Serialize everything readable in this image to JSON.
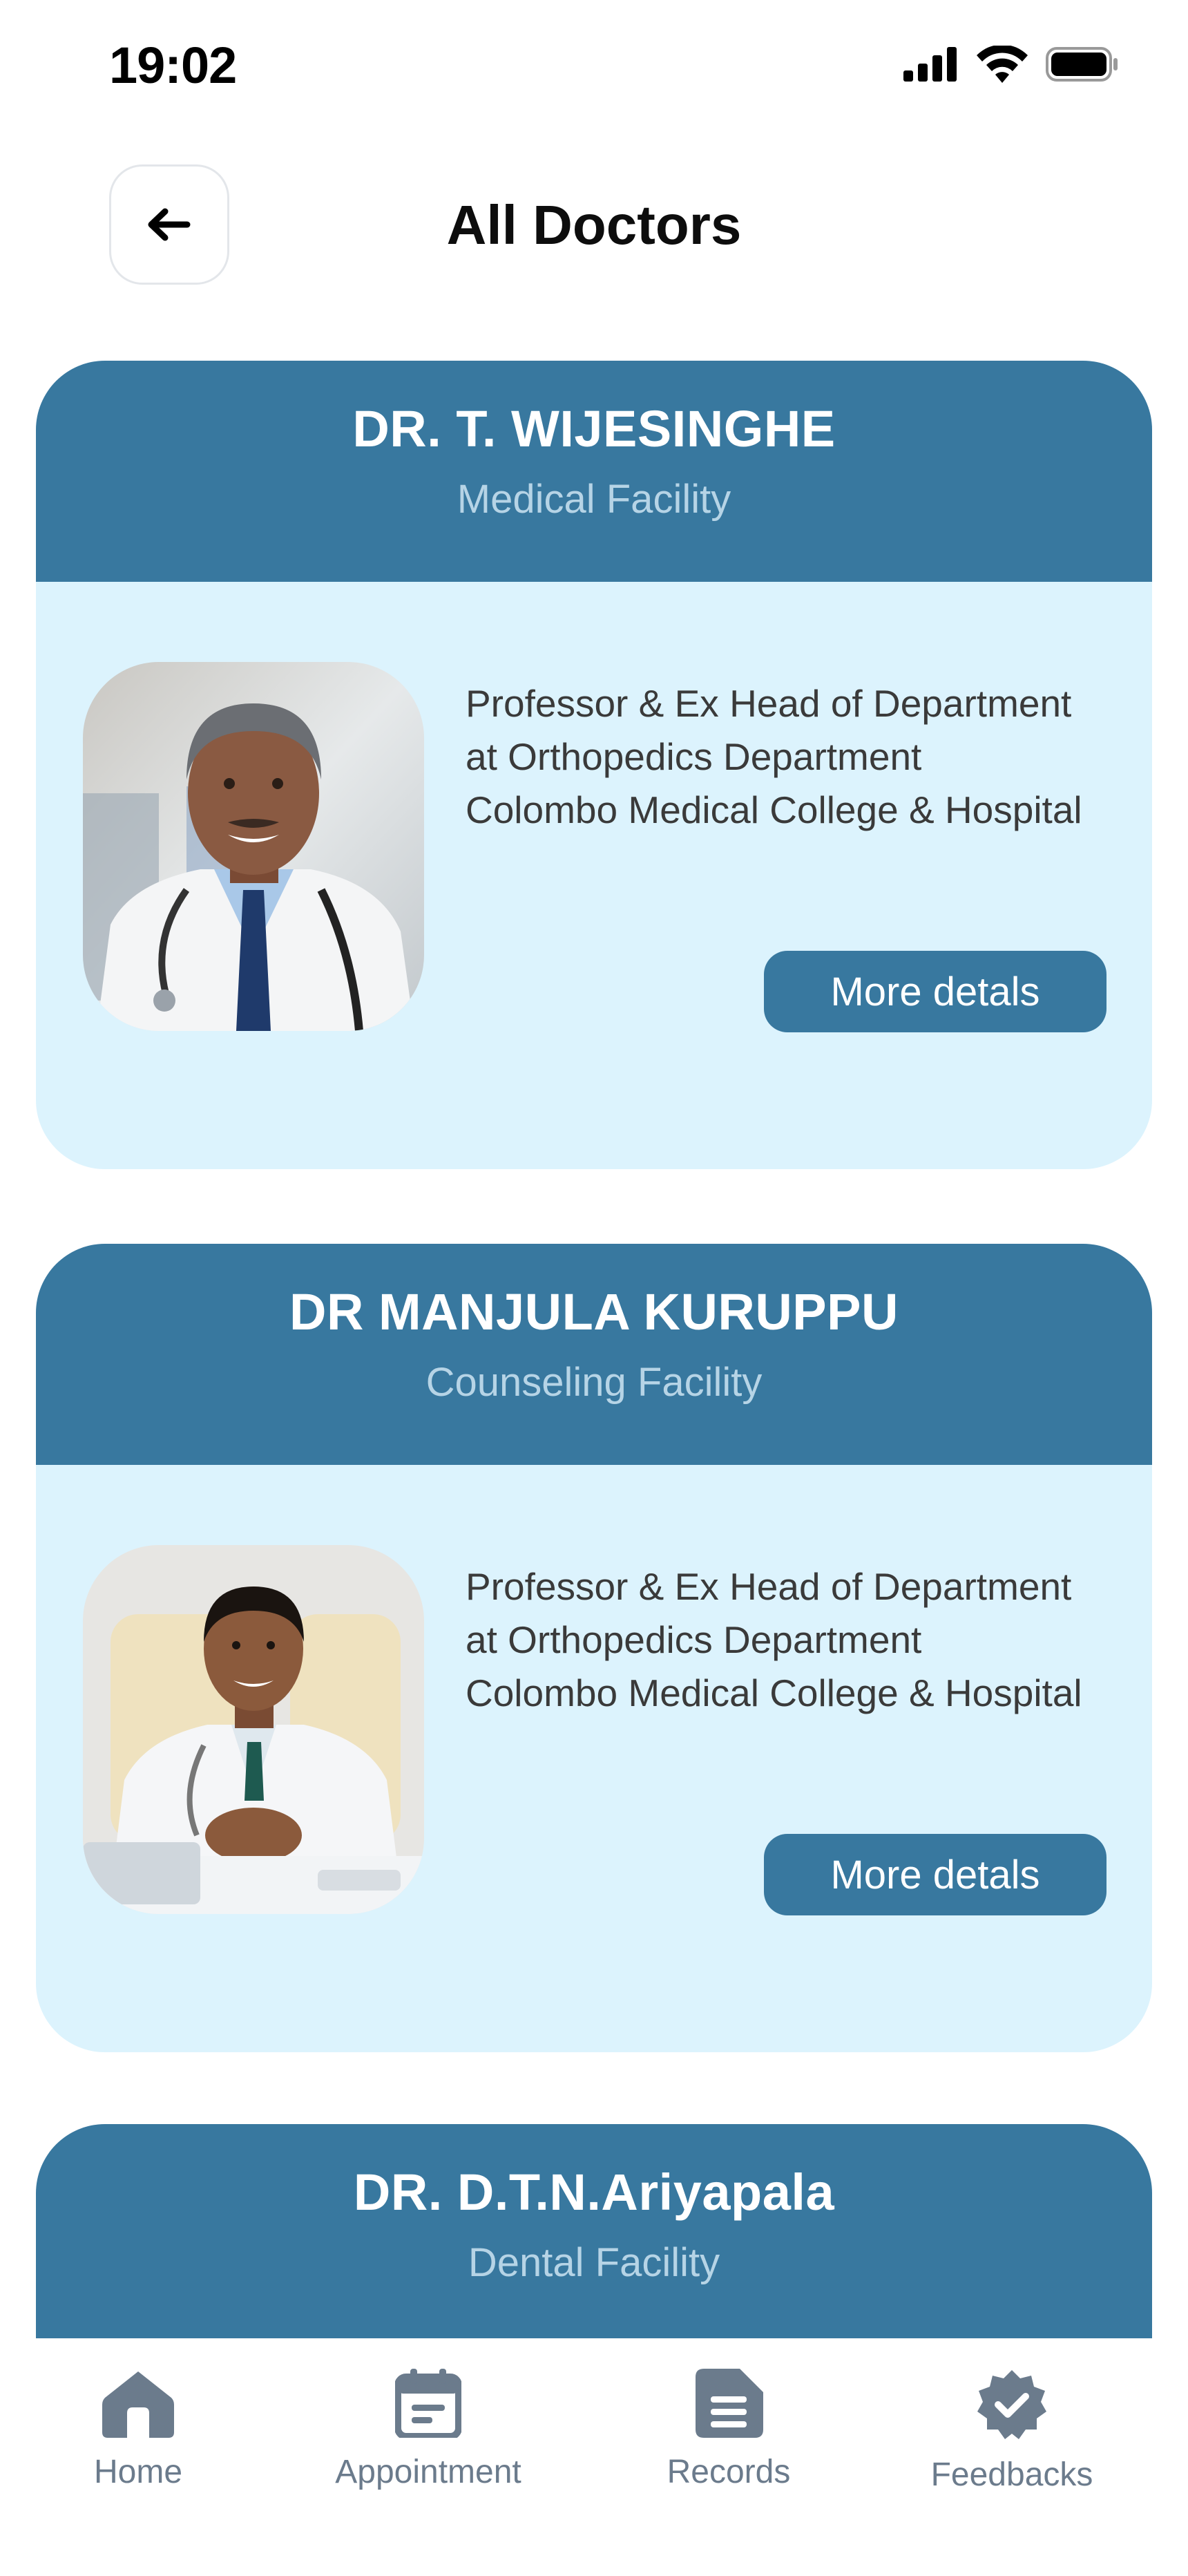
{
  "status_bar": {
    "time": "19:02"
  },
  "header": {
    "title": "All Doctors"
  },
  "doctors": [
    {
      "name": "DR. T. WIJESINGHE",
      "facility": "Medical Facility",
      "description": [
        "Professor &  Ex Head of Department",
        "at Orthopedics Department",
        "Colombo Medical College & Hospital"
      ],
      "button_label": "More detals"
    },
    {
      "name": "DR MANJULA KURUPPU",
      "facility": "Counseling Facility",
      "description": [
        "Professor &  Ex Head of Department",
        "at Orthopedics Department",
        "Colombo Medical College & Hospital"
      ],
      "button_label": "More detals"
    },
    {
      "name": "DR. D.T.N.Ariyapala",
      "facility": "Dental Facility"
    }
  ],
  "bottom_nav": {
    "items": [
      {
        "label": "Home",
        "icon": "home-icon"
      },
      {
        "label": "Appointment",
        "icon": "calendar-icon"
      },
      {
        "label": "Records",
        "icon": "document-icon"
      },
      {
        "label": "Feedbacks",
        "icon": "badge-check-icon"
      }
    ]
  },
  "colors": {
    "header_blue": "#38789f",
    "card_body": "#dcf3fd",
    "nav_icon": "#6b7b8c"
  }
}
